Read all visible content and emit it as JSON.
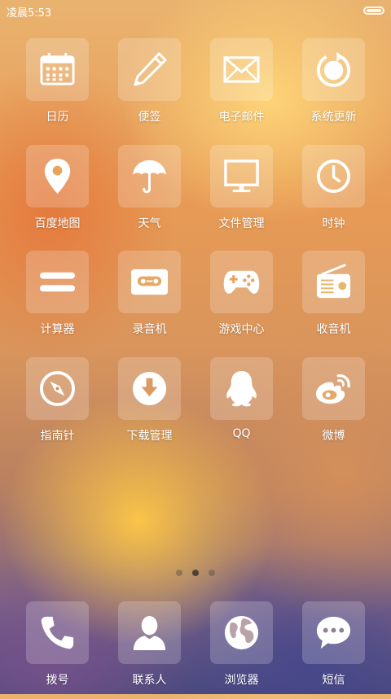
{
  "status_bar": {
    "time": "凌晨5:53"
  },
  "apps": [
    {
      "label": "日历",
      "icon": "calendar-icon"
    },
    {
      "label": "便签",
      "icon": "pen-icon"
    },
    {
      "label": "电子邮件",
      "icon": "mail-icon"
    },
    {
      "label": "系统更新",
      "icon": "update-icon"
    },
    {
      "label": "百度地图",
      "icon": "map-pin-icon"
    },
    {
      "label": "天气",
      "icon": "umbrella-icon"
    },
    {
      "label": "文件管理",
      "icon": "monitor-icon"
    },
    {
      "label": "时钟",
      "icon": "clock-icon"
    },
    {
      "label": "计算器",
      "icon": "equals-icon"
    },
    {
      "label": "录音机",
      "icon": "cassette-icon"
    },
    {
      "label": "游戏中心",
      "icon": "gamepad-icon"
    },
    {
      "label": "收音机",
      "icon": "radio-icon"
    },
    {
      "label": "指南针",
      "icon": "compass-icon"
    },
    {
      "label": "下载管理",
      "icon": "download-icon"
    },
    {
      "label": "QQ",
      "icon": "qq-penguin-icon"
    },
    {
      "label": "微博",
      "icon": "weibo-icon"
    }
  ],
  "pager": {
    "pages": 3,
    "active_page": 2
  },
  "dock": [
    {
      "label": "拨号",
      "icon": "phone-icon"
    },
    {
      "label": "联系人",
      "icon": "person-icon"
    },
    {
      "label": "浏览器",
      "icon": "globe-icon"
    },
    {
      "label": "短信",
      "icon": "chat-bubble-icon"
    }
  ],
  "colors": {
    "icon": "#ffffff",
    "tile": "rgba(255,255,255,0.2)"
  }
}
